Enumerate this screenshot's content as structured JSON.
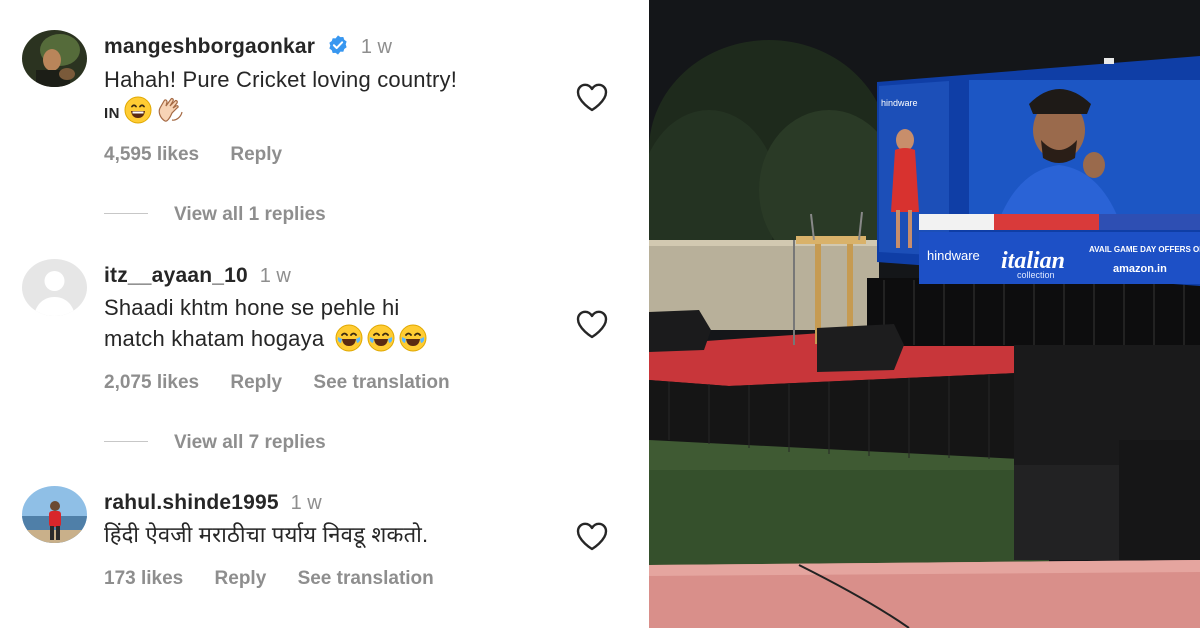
{
  "comments": [
    {
      "username": "mangeshborgaonkar",
      "verified": true,
      "time": "1 w",
      "lines": [
        "Hahah! Pure Cricket loving country!",
        "IN"
      ],
      "likes": "4,595 likes",
      "reply": "Reply",
      "view_replies": "View all 1 replies"
    },
    {
      "username": "itz__ayaan_10",
      "verified": false,
      "time": "1 w",
      "lines": [
        "Shaadi khtm hone se pehle hi",
        "match khatam hogaya"
      ],
      "likes": "2,075 likes",
      "reply": "Reply",
      "see_translation": "See translation",
      "view_replies": "View all 7 replies"
    },
    {
      "username": "rahul.shinde1995",
      "verified": false,
      "time": "1 w",
      "lines": [
        "हिंदी ऐवजी मराठीचा पर्याय निवडू शकतो."
      ],
      "likes": "173 likes",
      "reply": "Reply",
      "see_translation": "See translation"
    }
  ],
  "screen": {
    "brand": "hindware",
    "banner_brand": "hindware",
    "banner_title": "italian",
    "banner_sub": "collection",
    "offer_text": "AVAIL GAME DAY OFFERS ON",
    "store": "amazon.in"
  },
  "colors": {
    "verified_blue": "#3897f0",
    "muted_text": "#8e8e8e",
    "stage_red": "#c8363a"
  },
  "icons": [
    "verified-badge-icon",
    "heart-icon",
    "grinning-emoji-icon",
    "clapping-hands-icon",
    "joy-emoji-icon"
  ]
}
